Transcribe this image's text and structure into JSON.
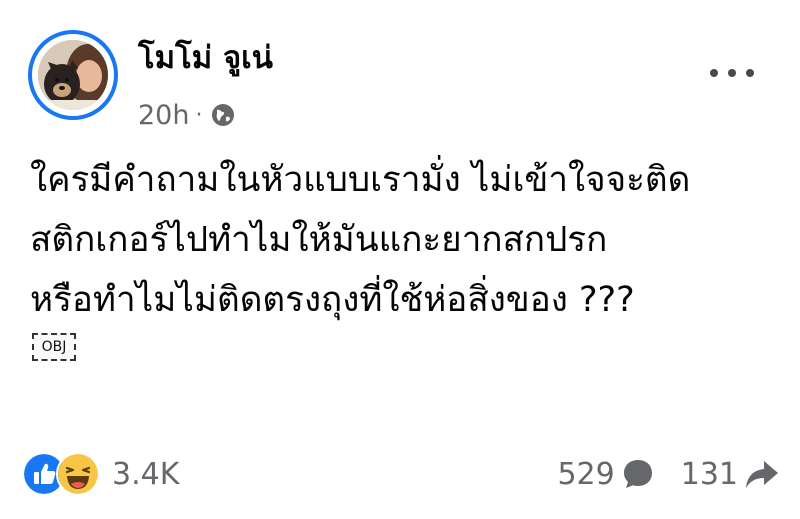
{
  "post": {
    "author": {
      "name": "โมโม่ จูเน่"
    },
    "time": "20h",
    "separator": "·",
    "privacy_icon": "globe-icon",
    "more_icon": "more-options-icon",
    "text_lines": [
      "ใครมีคำถามในหัวแบบเรามั่ง ไม่เข้าใจจะติด",
      "สติกเกอร์ไปทำไมให้มันแกะยากสกปรก",
      "หรือทำไมไม่ติดตรงถุงที่ใช้ห่อสิ่งของ ???"
    ],
    "object_placeholder": "OBJ",
    "reactions": {
      "icons": [
        "like-reaction-icon",
        "haha-reaction-icon"
      ],
      "count": "3.4K"
    },
    "comments": {
      "count": "529",
      "icon": "comment-icon"
    },
    "shares": {
      "count": "131",
      "icon": "share-icon"
    }
  },
  "colors": {
    "accent": "#1877f2",
    "text": "#050505",
    "secondary_text": "#65676b",
    "haha_yellow": "#f7c644"
  }
}
